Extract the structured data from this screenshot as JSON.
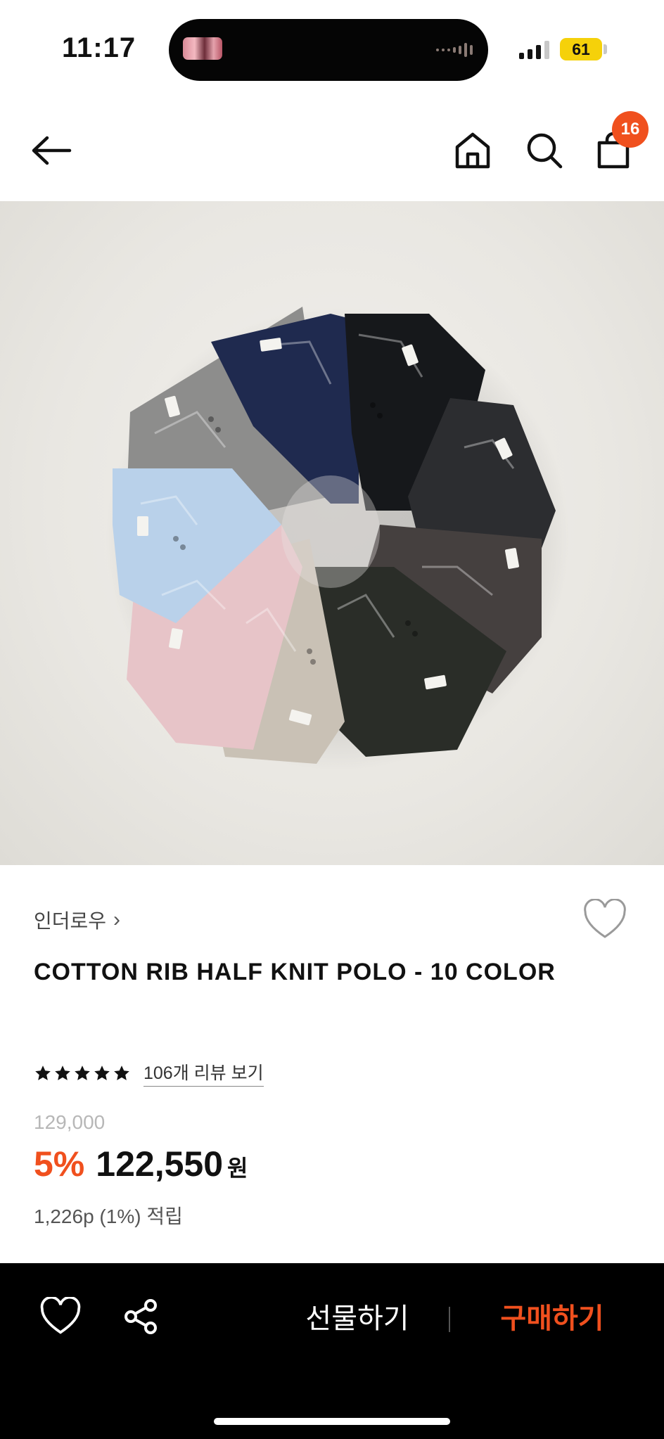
{
  "status_bar": {
    "time": "11:17",
    "battery_level": "61",
    "battery_color": "#f5d10a"
  },
  "nav": {
    "back_icon": "arrow-left-icon",
    "home_icon": "home-icon",
    "search_icon": "search-icon",
    "cart_icon": "shopping-bag-icon",
    "cart_count": "16",
    "badge_color": "#f0501e"
  },
  "product": {
    "brand": "인더로우",
    "brand_chevron": "›",
    "title": "COTTON RIB HALF KNIT POLO - 10 COLOR",
    "rating_stars": 5,
    "review_link": "106개 리뷰 보기",
    "original_price": "129,000",
    "discount": "5%",
    "sale_price": "122,550",
    "currency": "원",
    "points": "1,226p (1%) 적립",
    "accent_color": "#f0501e"
  },
  "bottom_bar": {
    "wishlist_icon": "heart-outline-icon",
    "share_icon": "share-icon",
    "gift_label": "선물하기",
    "buy_label": "구매하기"
  }
}
